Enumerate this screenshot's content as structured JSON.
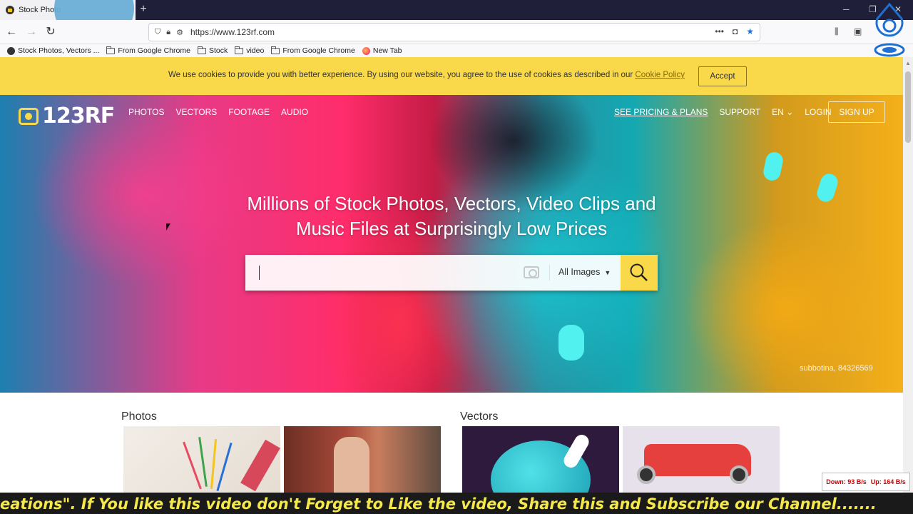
{
  "browser": {
    "tab_title": "Stock Photo",
    "new_tab_symbol": "+",
    "url": "https://www.123rf.com",
    "bookmarks": [
      {
        "label": "Stock Photos, Vectors ...",
        "icon": "site-favicon"
      },
      {
        "label": "From Google Chrome",
        "icon": "folder-icon"
      },
      {
        "label": "Stock",
        "icon": "folder-icon"
      },
      {
        "label": "video",
        "icon": "folder-icon"
      },
      {
        "label": "From Google Chrome",
        "icon": "folder-icon"
      },
      {
        "label": "New Tab",
        "icon": "firefox-icon"
      }
    ]
  },
  "cookie_banner": {
    "message": "We use cookies to provide you with better experience. By using our website, you agree to the use of cookies as described in our ",
    "link": "Cookie Policy",
    "accept": "Accept",
    "color": "#f9d849"
  },
  "site": {
    "logo": "123RF",
    "nav": [
      "PHOTOS",
      "VECTORS",
      "FOOTAGE",
      "AUDIO"
    ],
    "pricing": "SEE PRICING & PLANS",
    "support": "SUPPORT",
    "language": "EN",
    "login": "LOGIN",
    "signup": "SIGN UP",
    "headline_line1": "Millions of Stock Photos, Vectors, Video Clips and",
    "headline_line2": "Music Files at Surprisingly Low Prices",
    "search_scope": "All Images",
    "image_credit": "subbotina, 84326569",
    "accent": "#f9d849"
  },
  "sections": {
    "photos": "Photos",
    "vectors": "Vectors"
  },
  "overlay": {
    "net_down": "Down: 93 B/s",
    "net_up": "Up: 164 B/s",
    "ticker": "eations\". If You like this video don't Forget to Like the video, Share this and Subscribe our Channel......."
  }
}
